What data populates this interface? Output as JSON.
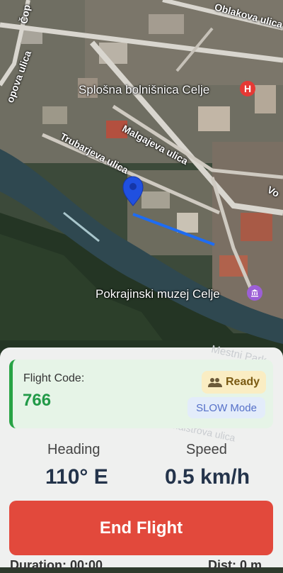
{
  "map": {
    "streets": [
      "Oblakova ulica",
      "Čop",
      "opova ulica",
      "Malgajeva ulica",
      "Trubarjeva ulica",
      "Vo"
    ],
    "places": {
      "hospital": "Splošna bolnišnica Celje",
      "museum": "Pokrajinski muzej Celje",
      "faint_labels": [
        "Mestni Park",
        "Maistrova ulica"
      ]
    },
    "poi_icons": {
      "hospital": "H"
    }
  },
  "flight": {
    "code_title": "Flight Code:",
    "code_value": "766",
    "status": "Ready",
    "mode": "SLOW Mode"
  },
  "stats": {
    "heading_label": "Heading",
    "heading_value": "110° E",
    "speed_label": "Speed",
    "speed_value": "0.5 km/h"
  },
  "actions": {
    "end_flight": "End Flight"
  },
  "footer": {
    "left_partial": "Duration: 00:00",
    "right_partial": "Dist: 0 m"
  },
  "colors": {
    "accent_green": "#229a48",
    "ready_badge_bg": "#faedc3",
    "mode_badge_text": "#5570c8",
    "end_button": "#e2493c",
    "route_line": "#1e6cf2",
    "marker": "#2050e0"
  }
}
